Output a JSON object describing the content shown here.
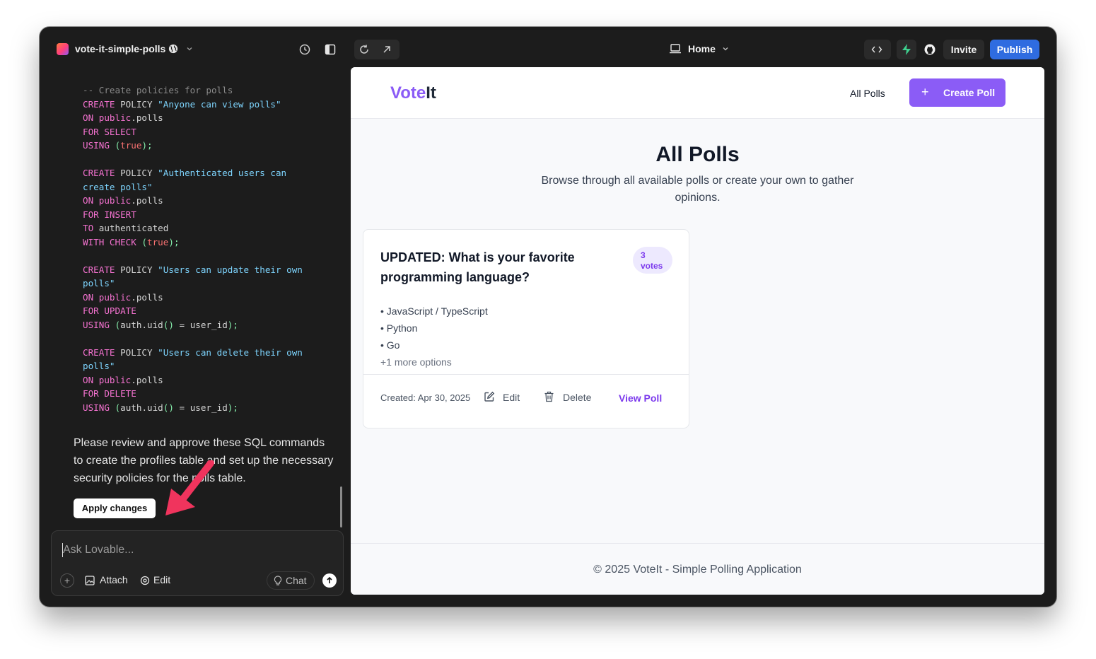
{
  "topbar": {
    "project_name": "vote-it-simple-polls",
    "page_selector": "Home",
    "invite_label": "Invite",
    "publish_label": "Publish"
  },
  "chat": {
    "code_lines": [
      "-- Create policies for polls",
      "CREATE POLICY \"Anyone can view polls\"",
      "ON public.polls",
      "FOR SELECT",
      "USING (true);",
      "CREATE POLICY \"Authenticated users can create polls\"",
      "ON public.polls",
      "FOR INSERT",
      "TO authenticated",
      "WITH CHECK (true);",
      "CREATE POLICY \"Users can update their own polls\"",
      "ON public.polls",
      "FOR UPDATE",
      "USING (auth.uid() = user_id);",
      "CREATE POLICY \"Users can delete their own polls\"",
      "ON public.polls",
      "FOR DELETE",
      "USING (auth.uid() = user_id);"
    ],
    "review_message": "Please review and approve these SQL commands to create the profiles table and set up the necessary security policies for the polls table.",
    "apply_label": "Apply changes",
    "input_placeholder": "Ask Lovable...",
    "attach_label": "Attach",
    "edit_label": "Edit",
    "chat_mode_label": "Chat"
  },
  "preview": {
    "brand_part1": "Vote",
    "brand_part2": "It",
    "nav_all_polls": "All Polls",
    "create_poll_label": "Create Poll",
    "page_title": "All Polls",
    "page_subtitle": "Browse through all available polls or create your own to gather opinions.",
    "poll": {
      "question": "UPDATED: What is your favorite programming language?",
      "votes_count": "3",
      "votes_label": "votes",
      "options": [
        "• JavaScript / TypeScript",
        "• Python",
        "• Go"
      ],
      "more_options": "+1 more options",
      "created": "Created: Apr 30, 2025",
      "edit_label": "Edit",
      "delete_label": "Delete",
      "view_label": "View Poll"
    },
    "footer": "© 2025 VoteIt - Simple Polling Application"
  },
  "colors": {
    "brand_purple": "#8b5cf6",
    "publish_blue": "#2f6ce0",
    "annotation_arrow": "#f0345d"
  },
  "icons": [
    "globe-icon",
    "chevron-down-icon",
    "history-icon",
    "sidebar-toggle-icon",
    "refresh-icon",
    "external-link-icon",
    "laptop-icon",
    "code-icon",
    "supabase-icon",
    "github-icon",
    "plus-icon",
    "image-icon",
    "target-icon",
    "lightbulb-icon",
    "arrow-up-icon",
    "edit-icon",
    "trash-icon"
  ]
}
